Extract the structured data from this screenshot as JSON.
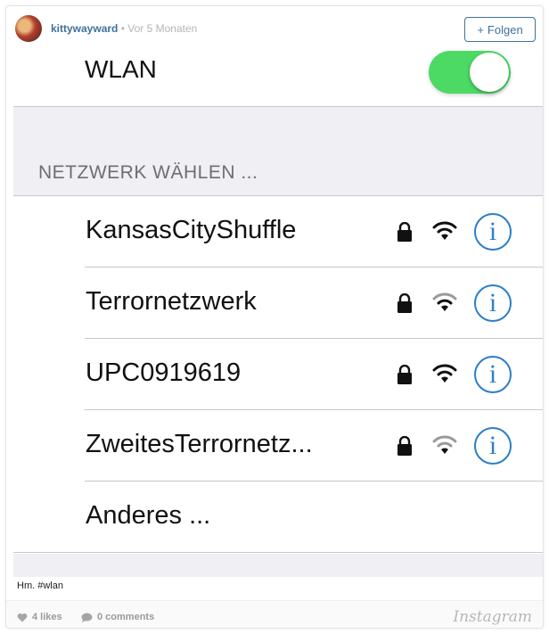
{
  "header": {
    "username": "kittywayward",
    "separator": "•",
    "time_ago": "Vor 5 Monaten",
    "follow_label": "Folgen",
    "follow_plus": "+"
  },
  "screenshot": {
    "wlan_label": "WLAN",
    "wlan_enabled": true,
    "section_title": "NETZWERK WÄHLEN ...",
    "networks": [
      {
        "name": "KansasCityShuffle",
        "locked": true,
        "info_glyph": "i"
      },
      {
        "name": "Terrornetzwerk",
        "locked": true,
        "info_glyph": "i"
      },
      {
        "name": "UPC0919619",
        "locked": true,
        "info_glyph": "i"
      },
      {
        "name": "ZweitesTerrornetz...",
        "locked": true,
        "info_glyph": "i"
      }
    ],
    "other_label": "Anderes ..."
  },
  "caption": "Hm. #wlan",
  "footer": {
    "likes": "4 likes",
    "comments": "0 comments",
    "brand": "Instagram"
  },
  "colors": {
    "username": "#3f729b",
    "toggle_on": "#4cd964",
    "info_blue": "#2a7fc9",
    "section_bg": "#efeff4"
  },
  "icons": {
    "lock": "lock-icon",
    "wifi": "wifi-icon",
    "info": "info-icon",
    "heart": "heart-icon",
    "comment": "comment-icon"
  }
}
